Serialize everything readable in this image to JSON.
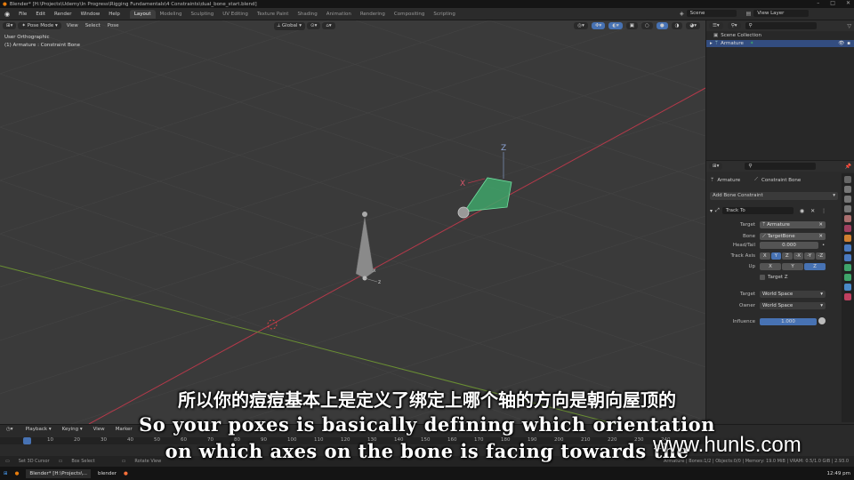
{
  "titlebar": {
    "text": "Blender* [H:\\Projects\\Udemy\\In Progress\\Rigging Fundamentals\\4 Constraints\\dual_bone_start.blend]"
  },
  "menu": [
    "File",
    "Edit",
    "Render",
    "Window",
    "Help"
  ],
  "workspaces": [
    "Layout",
    "Modeling",
    "Sculpting",
    "UV Editing",
    "Texture Paint",
    "Shading",
    "Animation",
    "Rendering",
    "Compositing",
    "Scripting"
  ],
  "scene": {
    "label": "Scene",
    "view_layer": "View Layer"
  },
  "viewport": {
    "mode": "Pose Mode",
    "menus": [
      "View",
      "Select",
      "Pose"
    ],
    "orientation": "Global",
    "overlay_line1": "User Orthographic",
    "overlay_line2": "(1) Armature : Constraint Bone",
    "axis_x": "X",
    "axis_z": "Z",
    "small_x": "x",
    "small_z": "z"
  },
  "outliner": {
    "scene_collection": "Scene Collection",
    "item": "Armature"
  },
  "properties": {
    "crumb_armature": "Armature",
    "crumb_bone": "Constraint Bone",
    "add_constraint": "Add Bone Constraint",
    "constraint_name": "Track To",
    "target_label": "Target",
    "target_value": "Armature",
    "bone_label": "Bone",
    "bone_value": "TargetBone",
    "headtail_label": "Head/Tail",
    "headtail_value": "0.000",
    "track_axis_label": "Track Axis",
    "track_axes": [
      "X",
      "Y",
      "Z",
      "-X",
      "-Y",
      "-Z"
    ],
    "up_label": "Up",
    "up_axes": [
      "X",
      "Y",
      "Z"
    ],
    "target_z": "Target Z",
    "space_target_label": "Target",
    "space_target_value": "World Space",
    "space_owner_label": "Owner",
    "space_owner_value": "World Space",
    "influence_label": "Influence",
    "influence_value": "1.000"
  },
  "timeline": {
    "menus": [
      "Playback",
      "Keying",
      "View",
      "Marker"
    ],
    "frames": [
      "1",
      "10",
      "20",
      "30",
      "40",
      "50",
      "60",
      "70",
      "80",
      "90",
      "100",
      "110",
      "120",
      "130",
      "140",
      "150",
      "160",
      "170",
      "180",
      "190",
      "200",
      "210",
      "220",
      "230",
      "240"
    ]
  },
  "statusbar": {
    "left1": "Set 3D Cursor",
    "left2": "Box Select",
    "left3": "Rotate View",
    "right": "Armature | Bones:1/2 | Objects:0/0 | Memory: 19.0 MiB | VRAM: 0.5/1.0 GiB | 2.93.0"
  },
  "taskbar": {
    "item1": "Blender* [H:\\Projects\\...",
    "item2": "blender",
    "time": "12:49 pm"
  },
  "subtitles": {
    "cn": "所以你的痘痘基本上是定义了绑定上哪个轴的方向是朝向屋顶的",
    "en1": "So your poxes is basically defining which orientation",
    "en2": "on which axes on the bone is facing towards the"
  },
  "watermark": "www.hunls.com",
  "colors": {
    "accent": "#4772b3",
    "bone_selected": "#3fa46a",
    "x_axis": "#b5394a",
    "y_axis": "#6a8f33"
  }
}
